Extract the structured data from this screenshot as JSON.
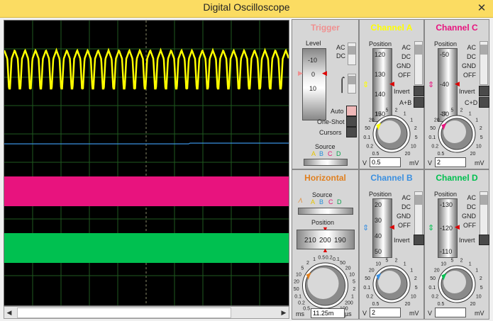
{
  "window": {
    "title": "Digital Oscilloscope",
    "close": "✕"
  },
  "colors": {
    "chA": "#ffff00",
    "chB": "#3a8fe0",
    "chC": "#e8137e",
    "chD": "#00c050",
    "trigger": "#f09090",
    "horizontal": "#e08020"
  },
  "trigger": {
    "title": "Trigger",
    "level_label": "Level",
    "level_ticks": [
      "-10",
      "0",
      "10"
    ],
    "ac": "AC",
    "dc": "DC",
    "modes": [
      "Auto",
      "One-Shot",
      "Cursors"
    ],
    "source_label": "Source",
    "sources": [
      "A",
      "B",
      "C",
      "D"
    ]
  },
  "channels": {
    "a": {
      "title": "Channel A",
      "position_label": "Position",
      "ticks": [
        "120",
        "130",
        "140",
        "150"
      ],
      "coupling": [
        "AC",
        "DC",
        "GND",
        "OFF"
      ],
      "invert": "Invert",
      "combo": "A+B",
      "dial_ticks": [
        "0.5",
        "0.2",
        "0.1",
        "50",
        "20",
        "10",
        "5",
        "2",
        "1",
        "1",
        "2",
        "5",
        "10",
        "20"
      ],
      "unit_left": "V",
      "value": "0.5",
      "unit_right": "mV"
    },
    "c": {
      "title": "Channel C",
      "position_label": "Position",
      "ticks": [
        "-50",
        "-40",
        "-30"
      ],
      "coupling": [
        "AC",
        "DC",
        "GND",
        "OFF"
      ],
      "invert": "Invert",
      "combo": "C+D",
      "dial_ticks": [
        "0.5",
        "0.2",
        "0.1",
        "50",
        "20",
        "10",
        "5",
        "2",
        "1",
        "1",
        "2",
        "5",
        "10",
        "20"
      ],
      "unit_left": "V",
      "value": "2",
      "unit_right": "mV"
    },
    "b": {
      "title": "Channel B",
      "position_label": "Position",
      "ticks": [
        "20",
        "30",
        "40",
        "50"
      ],
      "coupling": [
        "AC",
        "DC",
        "GND",
        "OFF"
      ],
      "invert": "Invert",
      "dial_ticks": [
        "0.5",
        "0.2",
        "0.1",
        "50",
        "20",
        "10",
        "5",
        "2",
        "1",
        "1",
        "2",
        "5",
        "10",
        "20"
      ],
      "unit_left": "V",
      "value": "2",
      "unit_right": "mV"
    },
    "d": {
      "title": "Channel D",
      "position_label": "Position",
      "ticks": [
        "-130",
        "-120",
        "-110"
      ],
      "coupling": [
        "AC",
        "DC",
        "GND",
        "OFF"
      ],
      "invert": "Invert",
      "dial_ticks": [
        "0.5",
        "0.2",
        "0.1",
        "50",
        "20",
        "10",
        "5",
        "2",
        "1",
        "1",
        "2",
        "5",
        "10",
        "20"
      ],
      "unit_left": "V",
      "value": "",
      "unit_right": "mV"
    }
  },
  "horizontal": {
    "title": "Horizontal",
    "source_label": "Source",
    "sources": [
      "A",
      "B",
      "C",
      "D"
    ],
    "position_label": "Position",
    "position_ticks": [
      "210",
      "200",
      "190"
    ],
    "dial_ticks": [
      "0.5",
      "0.2",
      "0.1",
      "50",
      "20",
      "10",
      "5",
      "2",
      "1",
      "0.5",
      "0.2",
      "0.1",
      "50",
      "20",
      "10",
      "5",
      "2",
      "1",
      "200",
      "100"
    ],
    "unit_left": "ms",
    "value": "11.25m",
    "unit_right": "µs"
  }
}
